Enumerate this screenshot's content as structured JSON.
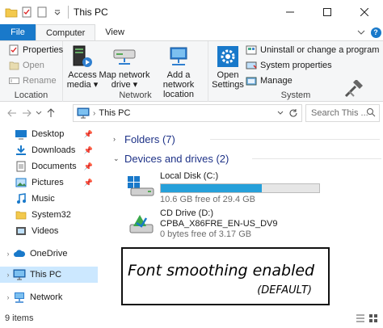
{
  "window": {
    "title": "This PC"
  },
  "tabs": [
    {
      "label": "File"
    },
    {
      "label": "Computer"
    },
    {
      "label": "View"
    }
  ],
  "ribbon": {
    "location": {
      "label": "Location",
      "properties": "Properties",
      "open": "Open",
      "rename": "Rename"
    },
    "network": {
      "label": "Network",
      "access_media": [
        "Access",
        "media ▾"
      ],
      "map_drive": [
        "Map network",
        "drive ▾"
      ],
      "add_location": [
        "Add a network",
        "location"
      ]
    },
    "system": {
      "label": "System",
      "open_settings": [
        "Open",
        "Settings"
      ],
      "uninstall": "Uninstall or change a program",
      "system_properties": "System properties",
      "manage": "Manage"
    }
  },
  "address": {
    "crumb": "This PC",
    "search_placeholder": "Search This ..."
  },
  "navpane": {
    "items": [
      {
        "label": "Desktop"
      },
      {
        "label": "Downloads"
      },
      {
        "label": "Documents"
      },
      {
        "label": "Pictures"
      },
      {
        "label": "Music"
      },
      {
        "label": "System32"
      },
      {
        "label": "Videos"
      },
      {
        "label": "OneDrive"
      },
      {
        "label": "This PC"
      },
      {
        "label": "Network"
      }
    ]
  },
  "content": {
    "folders_heading": "Folders (7)",
    "devices_heading": "Devices and drives (2)",
    "drives": [
      {
        "name": "Local Disk (C:)",
        "free": "10.6 GB free of 29.4 GB",
        "used_fraction": 0.64
      },
      {
        "name": "CD Drive (D:)",
        "label": "CPBA_X86FRE_EN-US_DV9",
        "free": "0 bytes free of 3.17 GB",
        "used_fraction": 1.0
      }
    ]
  },
  "annotation": {
    "line1": "Font smoothing enabled",
    "line2": "(DEFAULT)"
  },
  "status": {
    "items": "9 items"
  },
  "colors": {
    "accent": "#1979ca",
    "selected": "#cce8ff",
    "drive_bar": "#26a0da",
    "heading": "#1e3287"
  }
}
